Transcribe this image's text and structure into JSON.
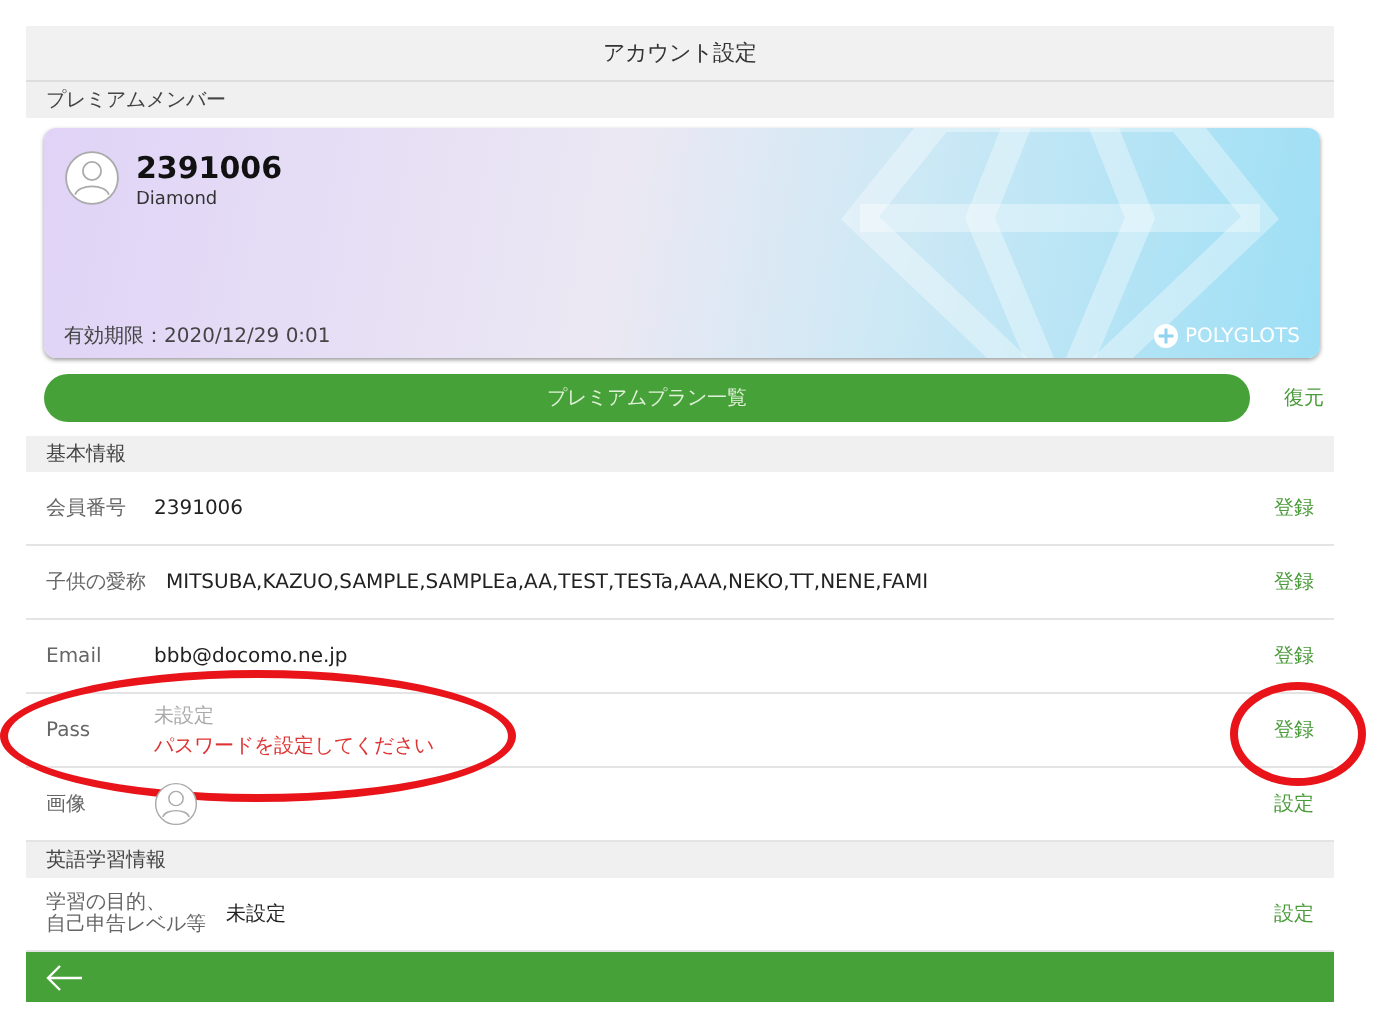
{
  "window": {
    "title": "アカウント設定"
  },
  "premium": {
    "header": "プレミアムメンバー",
    "card": {
      "member_id": "2391006",
      "rank": "Diamond",
      "expiry": "有効期限：2020/12/29 0:01",
      "brand": "POLYGLOTS"
    },
    "plan_button": "プレミアムプラン一覧",
    "restore_link": "復元"
  },
  "sections": [
    {
      "header": "基本情報",
      "rows": [
        {
          "kind": "text",
          "label": "会員番号",
          "value": "2391006",
          "action": "登録"
        },
        {
          "kind": "text",
          "label": "子供の愛称",
          "value": "MITSUBA,KAZUO,SAMPLE,SAMPLEa,AA,TEST,TESTa,AAA,NEKO,TT,NENE,FAMI",
          "action": "登録"
        },
        {
          "kind": "text",
          "label": "Email",
          "value": "bbb@docomo.ne.jp",
          "action": "登録"
        },
        {
          "kind": "unset",
          "label": "Pass",
          "placeholder": "未設定",
          "hint": "パスワードを設定してください",
          "action": "登録",
          "label_circled": true,
          "action_circled": true
        },
        {
          "kind": "image",
          "label": "画像",
          "action": "設定"
        }
      ]
    },
    {
      "header": "英語学習情報",
      "rows": [
        {
          "kind": "text",
          "label": [
            "学習の目的、",
            "自己申告レベル等"
          ],
          "value": "未設定",
          "action": "設定"
        }
      ]
    }
  ]
}
